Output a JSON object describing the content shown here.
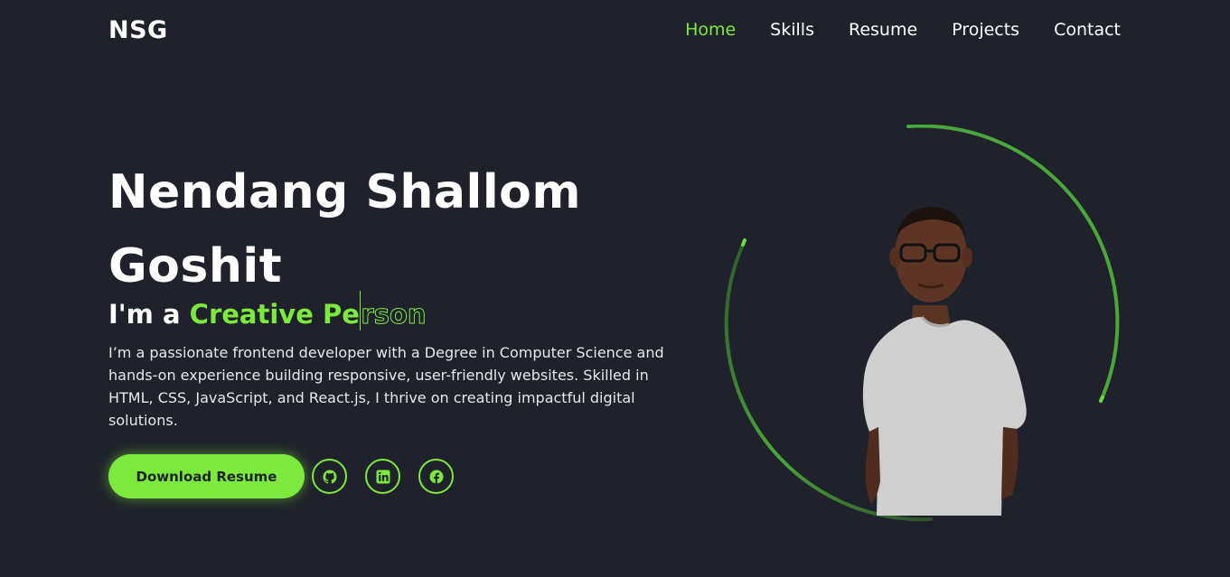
{
  "nav": {
    "logo": "NSG",
    "links": [
      {
        "label": "Home",
        "active": true
      },
      {
        "label": "Skills",
        "active": false
      },
      {
        "label": "Resume",
        "active": false
      },
      {
        "label": "Projects",
        "active": false
      },
      {
        "label": "Contact",
        "active": false
      }
    ]
  },
  "hero": {
    "name": "Nendang Shallom Goshit",
    "role_prefix": "I'm a",
    "role_typed": "Creative Pe",
    "role_rest": "rson",
    "bio": "I’m a passionate frontend developer with a Degree in Computer Science and hands-on experience building responsive, user-friendly websites. Skilled in HTML, CSS, JavaScript, and React.js, I thrive on creating impactful digital solutions.",
    "download_label": "Download Resume"
  },
  "social": [
    {
      "icon": "github-icon"
    },
    {
      "icon": "linkedin-icon"
    },
    {
      "icon": "facebook-icon"
    }
  ],
  "colors": {
    "background": "#1f222b",
    "accent": "#7bea3c",
    "text": "#ffffff"
  }
}
